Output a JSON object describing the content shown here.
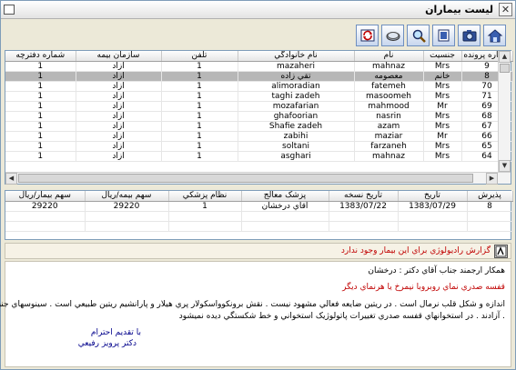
{
  "window": {
    "title": "ليست بيماران",
    "close_label": "✕"
  },
  "toolbar": {
    "buttons": [
      {
        "name": "home-button",
        "icon": "house-icon"
      },
      {
        "name": "camera-button",
        "icon": "camera-icon"
      },
      {
        "name": "slides-button",
        "icon": "slides-icon"
      },
      {
        "name": "search-button",
        "icon": "magnifier-icon"
      },
      {
        "name": "disk-button",
        "icon": "disk-icon"
      },
      {
        "name": "refresh-button",
        "icon": "refresh-icon"
      }
    ]
  },
  "patients": {
    "columns": [
      "شماره پرونده",
      "جنسيت",
      "نام",
      "نام خانوادگي",
      "تلفن",
      "سازمان بيمه",
      "شماره دفترچه"
    ],
    "rows": [
      [
        "9",
        "Mrs",
        "mahnaz",
        "mazaheri",
        "1",
        "آزاد",
        "1"
      ],
      [
        "8",
        "خانم",
        "معصومه",
        "تقي زاده",
        "1",
        "آزاد",
        "1"
      ],
      [
        "70",
        "Mrs",
        "fatemeh",
        "alimoradian",
        "1",
        "آزاد",
        "1"
      ],
      [
        "71",
        "Mrs",
        "masoomeh",
        "taghi zadeh",
        "1",
        "آزاد",
        "1"
      ],
      [
        "69",
        "Mr",
        "mahmood",
        "mozafarian",
        "1",
        "آزاد",
        "1"
      ],
      [
        "68",
        "Mrs",
        "nasrin",
        "ghafoorian",
        "1",
        "آزاد",
        "1"
      ],
      [
        "67",
        "Mrs",
        "azam",
        "Shafie zadeh",
        "1",
        "آزاد",
        "1"
      ],
      [
        "66",
        "Mr",
        "maziar",
        "zabihi",
        "1",
        "آزاد",
        "1"
      ],
      [
        "65",
        "Mrs",
        "farzaneh",
        "soltani",
        "1",
        "آزاد",
        "1"
      ],
      [
        "64",
        "Mrs",
        "mahnaz",
        "asghari",
        "1",
        "آزاد",
        "1"
      ]
    ]
  },
  "visits": {
    "columns": [
      "پذيرش",
      "تاريخ",
      "تاريخ نسخه",
      "پزشک معالج",
      "نظام پزشکي",
      "سهم بيمه/ريال",
      "سهم بيمار/ريال"
    ],
    "rows": [
      [
        "8",
        "1383/07/29",
        "1383/07/22",
        "آقاي درخشان",
        "1",
        "29220",
        "29220"
      ]
    ]
  },
  "report": {
    "message": "گزارش راديولوژي براي اين بيمار وجود ندارد"
  },
  "letter": {
    "greeting": "همکار ارجمند جناب آقاي دکتر : درخشان",
    "subject": "قفسه صدري نماي روبروبا نيمرخ يا هرنماي ديگر",
    "body_1": "اندازه و شکل قلب نرمال است . در ريتين ضايعه فعالي مشهود نيست . نقش برونکوواسکولار پري هيلار و پارانشيم ريتين طبيعي است . سينوسهاي جنبي",
    "body_2": ". آزادند . در استخوانهاي قفسه صدري تغييرات پاتولوژيک استخواني و خط شکستگي ديده نميشود",
    "closing": "با تقديم احترام",
    "signature": "دکتر پرويز رفيعي"
  },
  "colors": {
    "selected_row": "#b7b7b7",
    "warning_text": "#c00000",
    "signature_text": "#00008b"
  }
}
